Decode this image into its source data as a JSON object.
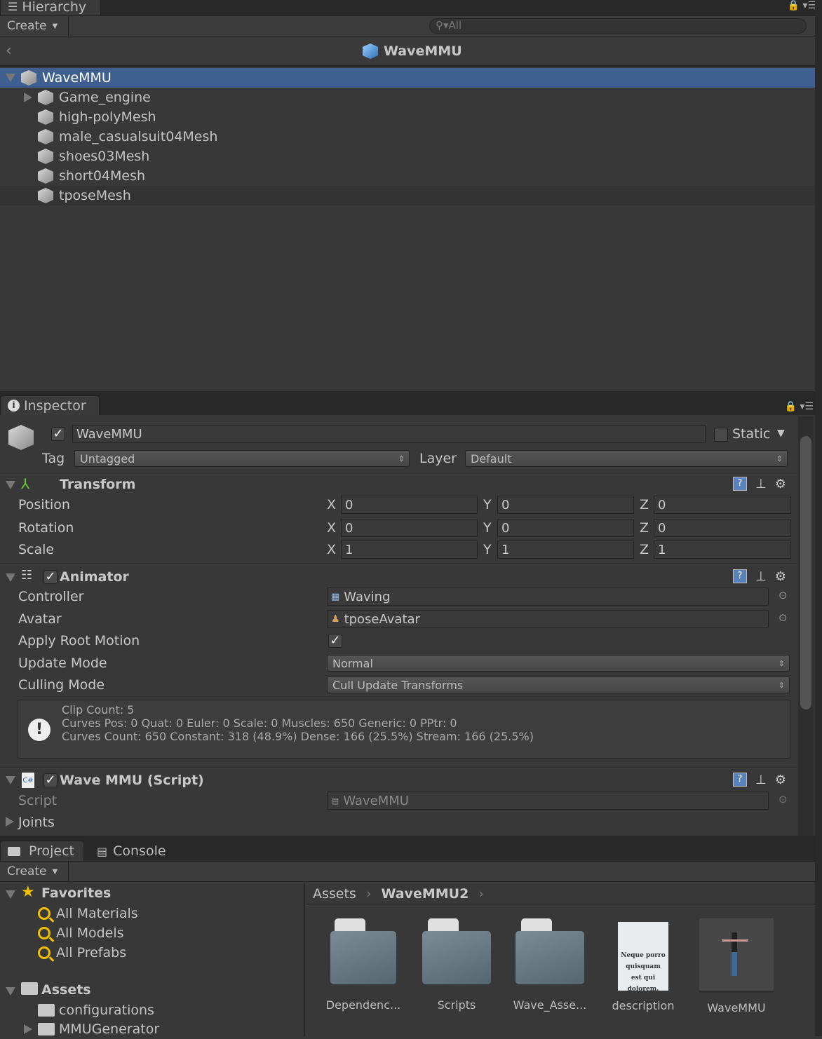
{
  "hierarchy": {
    "tab": "Hierarchy",
    "create": "Create",
    "search_placeholder": "All",
    "scene_title": "WaveMMU",
    "items": [
      {
        "label": "WaveMMU",
        "expanded": true,
        "selected": true
      },
      {
        "label": "Game_engine",
        "collapsed": true
      },
      {
        "label": "high-polyMesh"
      },
      {
        "label": "male_casualsuit04Mesh"
      },
      {
        "label": "shoes03Mesh"
      },
      {
        "label": "short04Mesh"
      },
      {
        "label": "tposeMesh",
        "hover": true
      }
    ]
  },
  "inspector": {
    "tab": "Inspector",
    "name": "WaveMMU",
    "active": true,
    "static_label": "Static",
    "static": false,
    "tag_label": "Tag",
    "tag": "Untagged",
    "layer_label": "Layer",
    "layer": "Default",
    "transform": {
      "title": "Transform",
      "rows": [
        {
          "label": "Position",
          "x": "0",
          "y": "0",
          "z": "0"
        },
        {
          "label": "Rotation",
          "x": "0",
          "y": "0",
          "z": "0"
        },
        {
          "label": "Scale",
          "x": "1",
          "y": "1",
          "z": "1"
        }
      ],
      "axes": {
        "x": "X",
        "y": "Y",
        "z": "Z"
      }
    },
    "animator": {
      "title": "Animator",
      "enabled": true,
      "controller_label": "Controller",
      "controller": "Waving",
      "avatar_label": "Avatar",
      "avatar": "tposeAvatar",
      "apply_root_label": "Apply Root Motion",
      "apply_root": true,
      "update_label": "Update Mode",
      "update": "Normal",
      "culling_label": "Culling Mode",
      "culling": "Cull Update Transforms",
      "info": [
        "Clip Count: 5",
        "Curves Pos: 0 Quat: 0 Euler: 0 Scale: 0 Muscles: 650 Generic: 0 PPtr: 0",
        "Curves Count: 650 Constant: 318 (48.9%) Dense: 166 (25.5%) Stream: 166 (25.5%)"
      ]
    },
    "script": {
      "title": "Wave MMU (Script)",
      "enabled": true,
      "script_label": "Script",
      "script": "WaveMMU",
      "joints_label": "Joints"
    }
  },
  "project": {
    "tab_project": "Project",
    "tab_console": "Console",
    "create": "Create",
    "favorites": {
      "label": "Favorites",
      "items": [
        "All Materials",
        "All Models",
        "All Prefabs"
      ]
    },
    "assets": {
      "label": "Assets",
      "items": [
        "configurations",
        "MMUGenerator"
      ]
    },
    "breadcrumb": [
      "Assets",
      "WaveMMU2"
    ],
    "grid": [
      {
        "label": "Dependenc...",
        "type": "folder"
      },
      {
        "label": "Scripts",
        "type": "folder"
      },
      {
        "label": "Wave_Asse...",
        "type": "folder"
      },
      {
        "label": "description",
        "type": "text",
        "preview": "Neque porro quisquam est qui dolorem."
      },
      {
        "label": "WaveMMU",
        "type": "model"
      }
    ]
  },
  "colors": {
    "selection": "#3e5f8f",
    "panel": "#383838",
    "tabbar": "#282828"
  }
}
